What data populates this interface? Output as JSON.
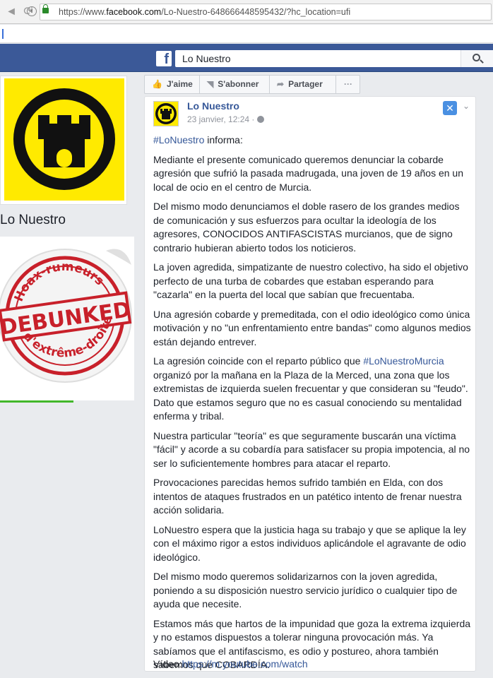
{
  "browser": {
    "url_prefix": "https://www.",
    "url_domain": "facebook.com",
    "url_path": "/Lo-Nuestro-648666448595432/?hc_location=ufi"
  },
  "header": {
    "search_value": "Lo Nuestro"
  },
  "page": {
    "name": "Lo Nuestro"
  },
  "overlay": {
    "stamp_top": "Hoax-rumeurs",
    "stamp_main": "DEBUNKED",
    "stamp_bottom": "d'extrême-droite"
  },
  "actions": {
    "like": "J'aime",
    "follow": "S'abonner",
    "share": "Partager",
    "more": "···"
  },
  "post": {
    "author": "Lo Nuestro",
    "date": "23 janvier, 12:24 ·",
    "hashtag_intro": "#LoNuestro",
    "intro_rest": " informa:",
    "p1": "Mediante el presente comunicado queremos denunciar la cobarde agresión que sufrió la pasada madrugada, una joven de 19 años en un local de ocio en el centro de Murcia.",
    "p2": "Del mismo modo denunciamos el doble rasero de los grandes medios de comunicación y sus esfuerzos para ocultar la ideología de los agresores, CONOCIDOS ANTIFASCISTAS murcianos, que de signo contrario hubieran abierto todos los noticieros.",
    "p3": "La joven agredida, simpatizante de nuestro colectivo, ha sido el objetivo perfecto de una turba de cobardes que estaban esperando para \"cazarla\" en la puerta del local que sabían que frecuentaba.",
    "p4": "Una agresión cobarde y premeditada, con el odio ideológico como única motivación y no \"un enfrentamiento entre bandas\" como algunos medios están dejando entrever.",
    "p5_a": "La agresión coincide con el reparto público que ",
    "p5_tag": "#LoNuestroMurcia",
    "p5_b": " organizó por la mañana en la Plaza de la Merced, una zona que los extremistas de izquierda suelen frecuentar y que consideran su \"feudo\". Dato que estamos seguro que no es casual conociendo su mentalidad enferma y tribal.",
    "p6": "Nuestra particular \"teoría\" es que seguramente buscarán una víctima \"fácil\" y acorde a su cobardía para satisfacer su propia impotencia, al no ser lo suficientemente hombres para atacar el reparto.",
    "p7": "Provocaciones parecidas hemos sufrido también en Elda, con dos intentos de ataques frustrados en un patético intento de frenar nuestra acción solidaria.",
    "p8": "LoNuestro espera que la justicia haga su trabajo y que se aplique la ley con el máximo rigor a estos individuos aplicándole el agravante de odio ideológico.",
    "p9": "Del mismo modo queremos solidarizarnos con la joven agredida, poniendo a su disposición nuestro servicio jurídico o cualquier tipo de ayuda que necesite.",
    "p10": "Estamos más que hartos de la impunidad que goza la extrema izquierda y no estamos dispuestos a tolerar ninguna provocación más. Ya sabíamos que el antifascismo, es odio y postureo, ahora también sabemos que COBARDÍA.",
    "video_label": "Vídeo:",
    "video_link": "https://m.youtube.com/watch"
  },
  "colors": {
    "fb_blue": "#3b5998",
    "link": "#365899",
    "logo_yellow": "#ffea00",
    "stamp_red": "#c8202a"
  }
}
